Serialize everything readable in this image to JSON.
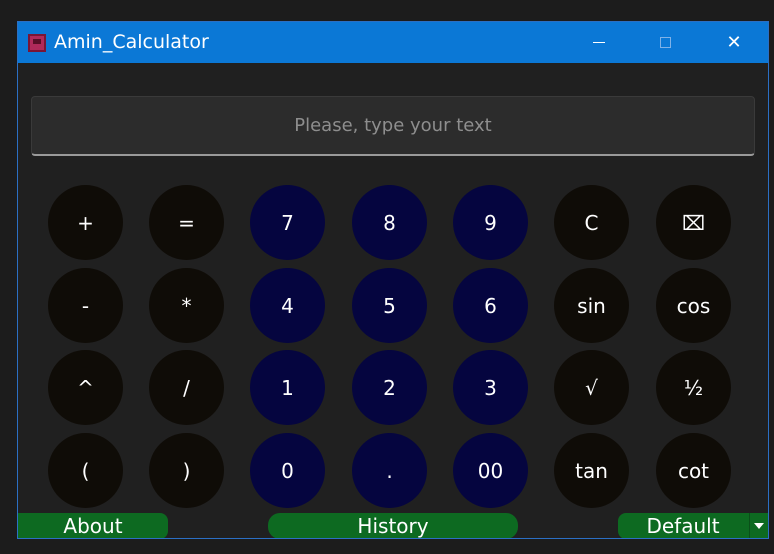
{
  "window": {
    "title": "Amin_Calculator",
    "minimize_label": "—",
    "close_label": "✕"
  },
  "input": {
    "placeholder": "Please, type your text",
    "value": ""
  },
  "keys": {
    "row1": [
      "+",
      "=",
      "7",
      "8",
      "9",
      "C",
      "⌧"
    ],
    "row2": [
      "-",
      "*",
      "4",
      "5",
      "6",
      "sin",
      "cos"
    ],
    "row3": [
      "^",
      "/",
      "1",
      "2",
      "3",
      "√",
      "½"
    ],
    "row4": [
      "(",
      ")",
      "0",
      ".",
      "00",
      "tan",
      "cot"
    ]
  },
  "bottom": {
    "about_label": "About",
    "history_label": "History",
    "default_label": "Default"
  },
  "colors": {
    "titlebar": "#0b78d6",
    "operator_key": "#0f0c07",
    "number_key": "#05053f",
    "green_button": "#0d6a21",
    "window_bg": "#202020"
  },
  "icons": {
    "app": "calculator-app-icon",
    "minimize": "minimize-icon",
    "maximize": "maximize-icon",
    "close": "close-icon",
    "dropdown": "chevron-down-icon"
  }
}
